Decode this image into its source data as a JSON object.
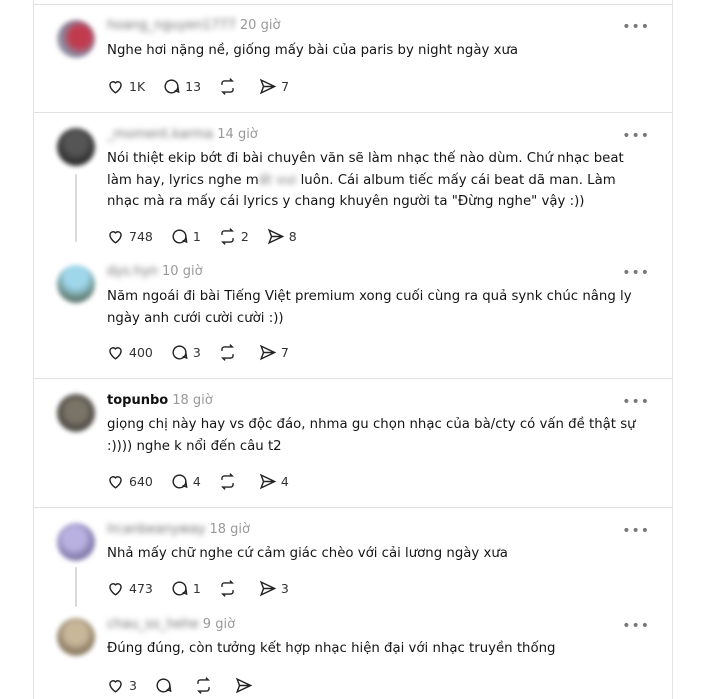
{
  "posts": [
    {
      "username": "hoang_nguyen1777",
      "time": "20 giờ",
      "text": "Nghe hơi nặng nề, giống mấy bài của paris by night ngày xưa",
      "likes": "1K",
      "replies": "13",
      "reposts": "",
      "shares": "7"
    },
    {
      "username": "_moment.karma",
      "time": "14 giờ",
      "text_before": "Nói thiệt ekip bớt đi bài chuyên văn sẽ làm nhạc thế nào dùm. Chứ nhạc beat làm hay, lyrics nghe m",
      "text_hidden": "ất vui",
      "text_after": " luôn. Cái album tiếc mấy cái beat dã man. Làm nhạc mà ra mấy cái lyrics y chang khuyên người ta \"Đừng nghe\" vậy :))",
      "likes": "748",
      "replies": "1",
      "reposts": "2",
      "shares": "8"
    },
    {
      "username": "dys.hyn",
      "time": "10 giờ",
      "text": "Năm ngoái đi bài Tiếng Việt premium xong cuối cùng ra quả synk chúc nâng ly ngày anh cưới cười cười :))",
      "likes": "400",
      "replies": "3",
      "reposts": "",
      "shares": "7"
    },
    {
      "username": "topunbo",
      "time": "18 giờ",
      "text": "giọng chị này hay vs độc đáo, nhma gu chọn nhạc của bà/cty có vấn đề thật sự :)))) nghe k nổi đến câu t2",
      "likes": "640",
      "replies": "4",
      "reposts": "",
      "shares": "4"
    },
    {
      "username": "lrcanbeanyway",
      "time": "18 giờ",
      "text": "Nhả mấy chữ nghe cứ cảm giác chèo với cải lương ngày xưa",
      "likes": "473",
      "replies": "1",
      "reposts": "",
      "shares": "3"
    },
    {
      "username": "chau_so_hehe",
      "time": "9 giờ",
      "text": "Đúng đúng, còn tưởng kết hợp nhạc hiện đại với nhạc truyền thống",
      "likes": "3",
      "replies": "",
      "reposts": "",
      "shares": ""
    }
  ],
  "more_label": "•••",
  "icons": [
    "heart-icon",
    "comment-icon",
    "repost-icon",
    "share-icon",
    "more-icon"
  ],
  "colors": {
    "text": "#101010",
    "muted": "#999999",
    "divider": "#e1e1e1"
  }
}
